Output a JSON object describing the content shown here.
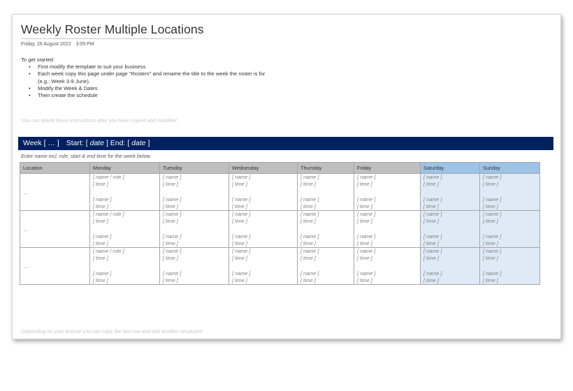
{
  "title": "Weekly Roster Multiple Locations",
  "date": "Friday, 26 August 2022",
  "time": "3:09 PM",
  "intro": {
    "heading": "To get started",
    "bullets": [
      "First modify the template to suit your business",
      "Each week copy this page under page \"Rosters\" and rename the title to the week the roster is for",
      "(e.g.: Week 3-9 June).",
      "Modify the Week & Dates",
      "Then create the schedule"
    ]
  },
  "instruction_note": "You can delete these instructions after you have copied and modified",
  "week_bar": {
    "week": "Week [ … ]",
    "start_label": "Start: [",
    "start_value": "date",
    "end_label": "]   End: [",
    "end_value": "date",
    "close": "]"
  },
  "enter_note": "Enter name incl. role, start & end time for the week below.",
  "table": {
    "headers": [
      "Location",
      "Monday",
      "Tuesday",
      "Wednesday",
      "Thursday",
      "Friday",
      "Saturday",
      "Sunday"
    ],
    "location_placeholder": "…",
    "name_role": "[ name / role ]",
    "name": "[ name ]",
    "time": "[ time ]"
  },
  "footer_note": "Depending on your license you can copy the last row and add another employee"
}
